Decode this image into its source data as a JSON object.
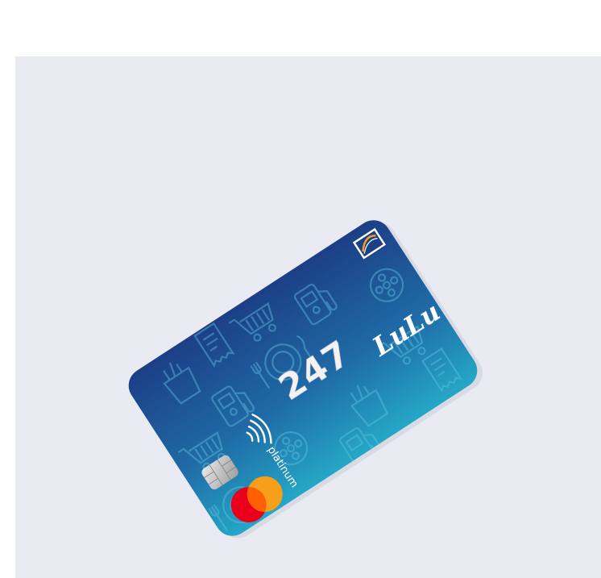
{
  "card": {
    "number_label": "247",
    "brand_script": "LuLu",
    "tier_label": "platinum",
    "network": "mastercard",
    "colors": {
      "card_top": "#1c3f86",
      "card_bottom": "#23a3c4",
      "mastercard_red": "#eb001b",
      "mastercard_orange": "#f79e1b",
      "background": "#eaebf2"
    },
    "icons": [
      "bank-logo-icon",
      "contactless-icon",
      "chip-icon",
      "shopping-cart-icon",
      "fuel-pump-icon",
      "film-reel-icon",
      "plate-cutlery-icon",
      "grocery-bag-icon",
      "receipt-icon"
    ]
  }
}
